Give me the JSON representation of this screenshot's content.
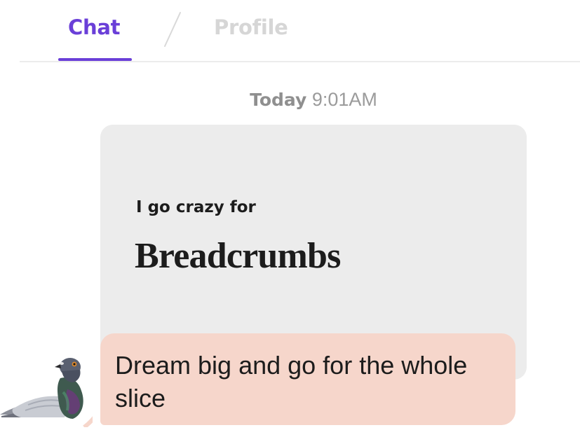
{
  "tabs": {
    "chat_label": "Chat",
    "profile_label": "Profile",
    "active": "Chat",
    "accent_color": "#6a3fd8",
    "inactive_color": "#d6d6d6"
  },
  "timestamp": {
    "day": "Today",
    "time": "9:01AM"
  },
  "prompt_card": {
    "prompt": "I go crazy for",
    "answer": "Breadcrumbs",
    "background_color": "#ececec"
  },
  "reply": {
    "text": "Dream big and go for the whole slice",
    "bubble_color": "#f6d6cb"
  },
  "avatar": {
    "icon": "pigeon-icon"
  }
}
